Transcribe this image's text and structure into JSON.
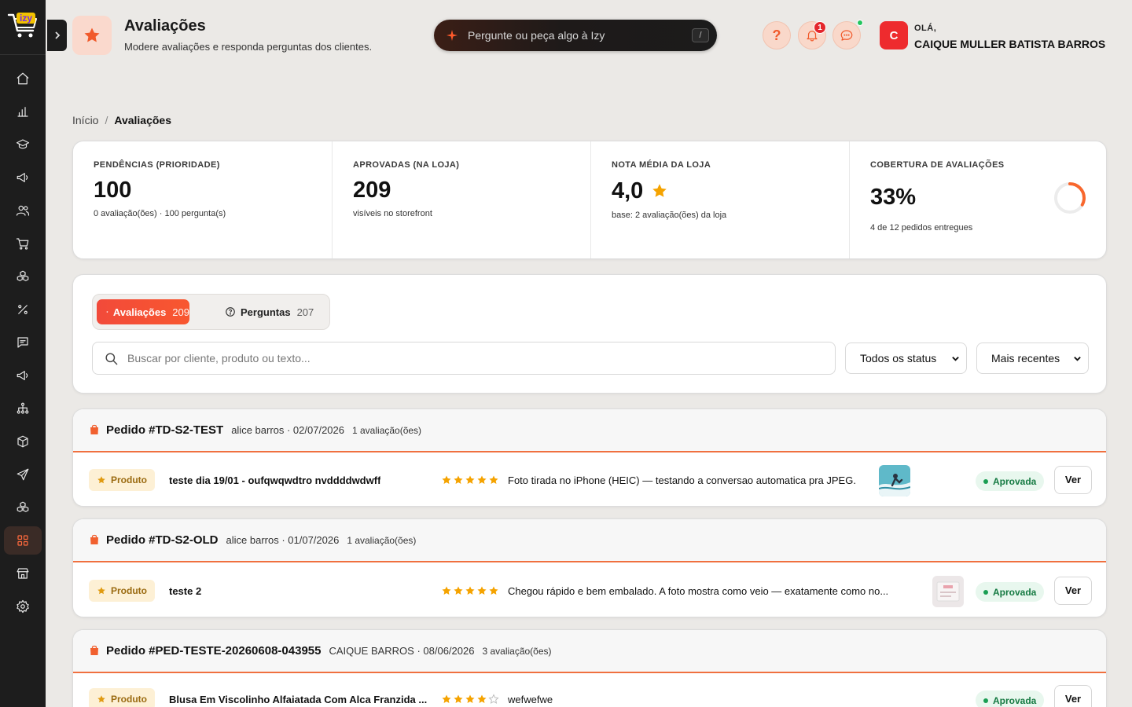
{
  "header": {
    "title": "Avaliações",
    "subtitle": "Modere avaliações e responda perguntas dos clientes.",
    "ask_placeholder": "Pergunte ou peça algo à Izy",
    "ask_shortcut": "/",
    "help_label": "?",
    "notification_count": "1",
    "greeting": "OLÁ,",
    "user_name": "CAIQUE MULLER BATISTA BARROS",
    "avatar_initial": "C"
  },
  "breadcrumb": {
    "home": "Início",
    "separator": "/",
    "current": "Avaliações"
  },
  "stats": [
    {
      "label": "PENDÊNCIAS (PRIORIDADE)",
      "value": "100",
      "note": "0 avaliação(ões) · 100 pergunta(s)"
    },
    {
      "label": "APROVADAS (NA LOJA)",
      "value": "209",
      "note": "visíveis no storefront"
    },
    {
      "label": "NOTA MÉDIA DA LOJA",
      "value": "4,0",
      "note": "base: 2 avaliação(ões) da loja"
    },
    {
      "label": "COBERTURA DE AVALIAÇÕES",
      "value": "33%",
      "note": "4 de 12 pedidos entregues",
      "coverage": 0.33
    }
  ],
  "tabs": [
    {
      "label": "Avaliações",
      "count": "209",
      "active": true
    },
    {
      "label": "Perguntas",
      "count": "207",
      "active": false
    }
  ],
  "filters": {
    "search_placeholder": "Buscar por cliente, produto ou texto...",
    "status_selected": "Todos os status",
    "sort_selected": "Mais recentes"
  },
  "orders": [
    {
      "title": "Pedido #TD-S2-TEST",
      "meta": "alice barros · 02/07/2026",
      "count": "1 avaliação(ões)",
      "review": {
        "badge": "Produto",
        "product": "teste dia 19/01 - oufqwqwdtro nvddddwdwff",
        "rating": 5,
        "text": "Foto tirada no iPhone (HEIC) — testando a conversao automatica pra JPEG.",
        "status": "Aprovada",
        "action": "Ver"
      }
    },
    {
      "title": "Pedido #TD-S2-OLD",
      "meta": "alice barros · 01/07/2026",
      "count": "1 avaliação(ões)",
      "review": {
        "badge": "Produto",
        "product": "teste 2",
        "rating": 5,
        "text": "Chegou rápido e bem embalado. A foto mostra como veio — exatamente como no...",
        "status": "Aprovada",
        "action": "Ver"
      }
    },
    {
      "title": "Pedido #PED-TESTE-20260608-043955",
      "meta": "CAIQUE BARROS · 08/06/2026",
      "count": "3 avaliação(ões)",
      "review": {
        "badge": "Produto",
        "product": "Blusa Em Viscolinho Alfaiatada Com Alca Franzida ...",
        "rating": 4,
        "text": "wefwefwe",
        "status": "Aprovada",
        "action": "Ver"
      }
    }
  ],
  "colors": {
    "accent": "#f15a2b",
    "sidebar": "#1d1d1d",
    "star": "#f5a300",
    "approved": "#157a42"
  }
}
